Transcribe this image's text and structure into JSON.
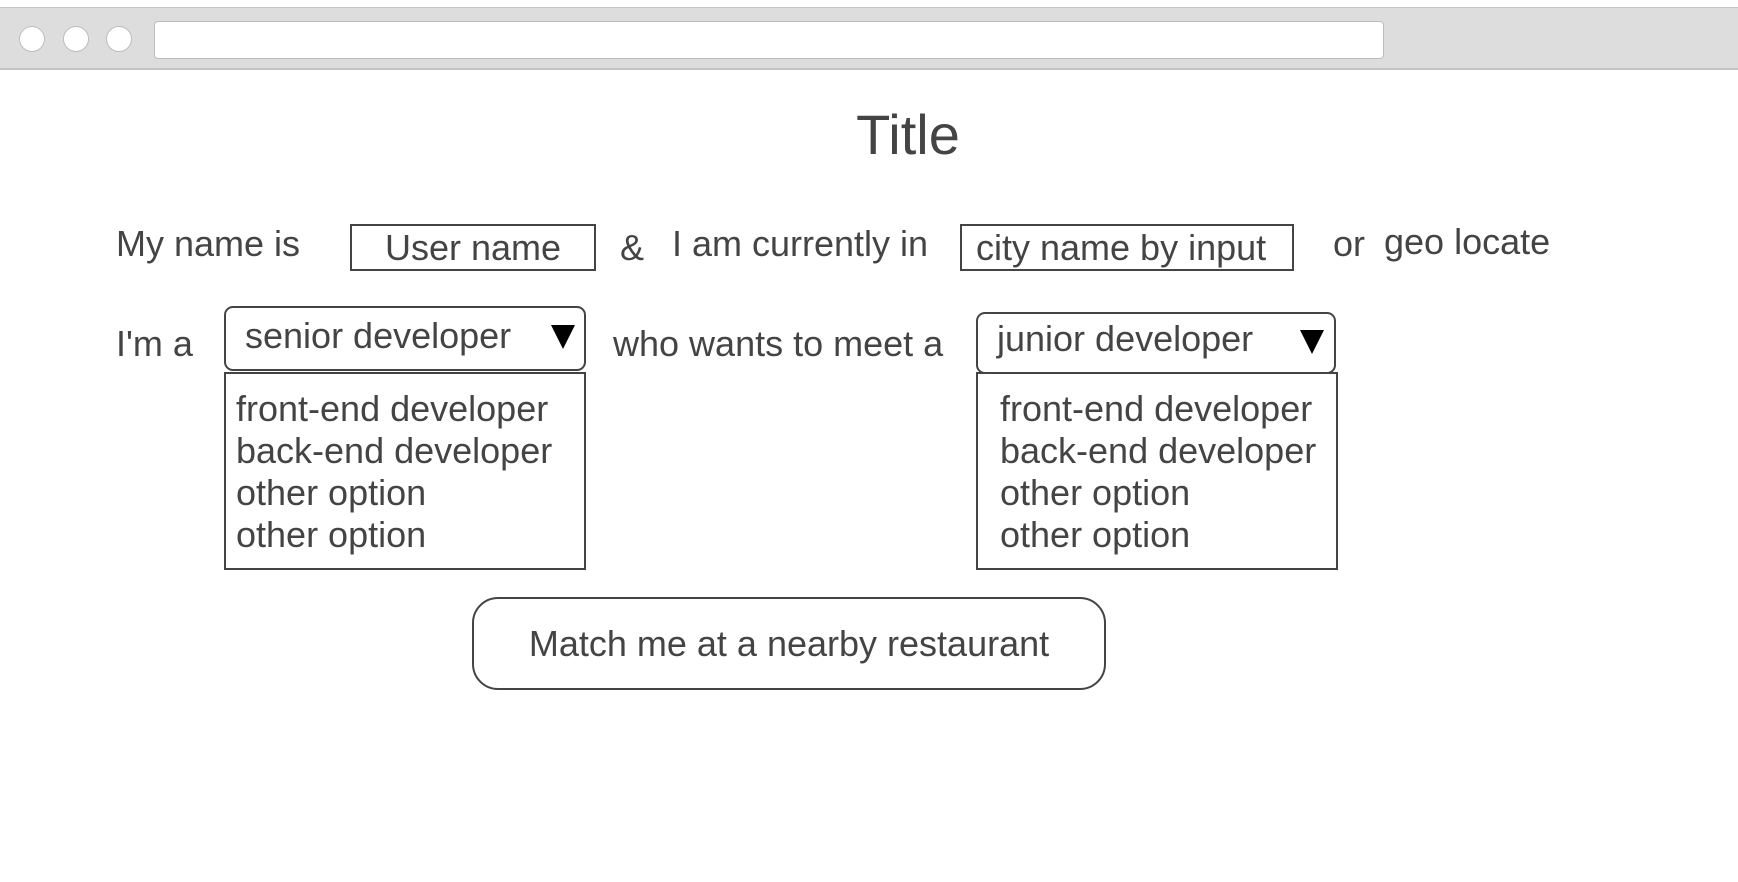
{
  "page": {
    "title": "Title"
  },
  "intro": {
    "name_prefix": "My name is",
    "name_placeholder": "User name",
    "ampersand": "&",
    "location_prefix": "I am currently in",
    "city_placeholder": "city name by input",
    "or_label": "or",
    "geo_locate_label": "geo locate"
  },
  "roles": {
    "self_prefix": "I'm a",
    "self_selected": "senior developer",
    "self_options": [
      "front-end developer",
      "back-end developer",
      "other option",
      "other option"
    ],
    "meet_prefix": "who wants to meet a",
    "meet_selected": "junior developer",
    "meet_options": [
      "front-end developer",
      "back-end developer",
      "other option",
      "other option"
    ]
  },
  "action": {
    "match_label": "Match me at a nearby restaurant"
  }
}
